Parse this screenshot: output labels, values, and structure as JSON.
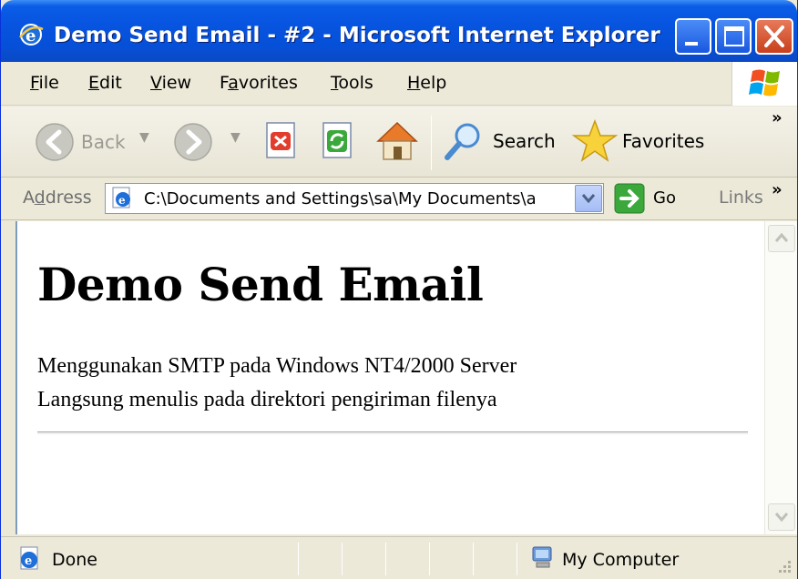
{
  "window": {
    "title": "Demo Send Email - #2 - Microsoft Internet Explorer"
  },
  "menu": {
    "items": [
      {
        "label": "File",
        "u": "F",
        "rest": "ile"
      },
      {
        "label": "Edit",
        "u": "E",
        "rest": "dit"
      },
      {
        "label": "View",
        "u": "V",
        "rest": "iew"
      },
      {
        "label": "Favorites",
        "pre": "F",
        "u": "a",
        "rest": "vorites"
      },
      {
        "label": "Tools",
        "u": "T",
        "rest": "ools"
      },
      {
        "label": "Help",
        "u": "H",
        "rest": "elp"
      }
    ]
  },
  "toolbar": {
    "back_label": "Back",
    "search_label": "Search",
    "favorites_label": "Favorites",
    "overflow": "»"
  },
  "address": {
    "label_pre": "A",
    "label_u": "d",
    "label_rest": "dress",
    "value": "C:\\Documents and Settings\\sa\\My Documents\\a",
    "go_label": "Go",
    "links_label": "Links",
    "overflow": "»"
  },
  "page": {
    "heading": "Demo Send Email",
    "line1": "Menggunakan SMTP pada Windows NT4/2000 Server",
    "line2": "Langsung menulis pada direktori pengiriman filenya"
  },
  "status": {
    "text": "Done",
    "zone": "My Computer"
  },
  "colors": {
    "titlebar": "#0754e0",
    "chrome": "#ece9d8",
    "close_button": "#c8401c"
  }
}
